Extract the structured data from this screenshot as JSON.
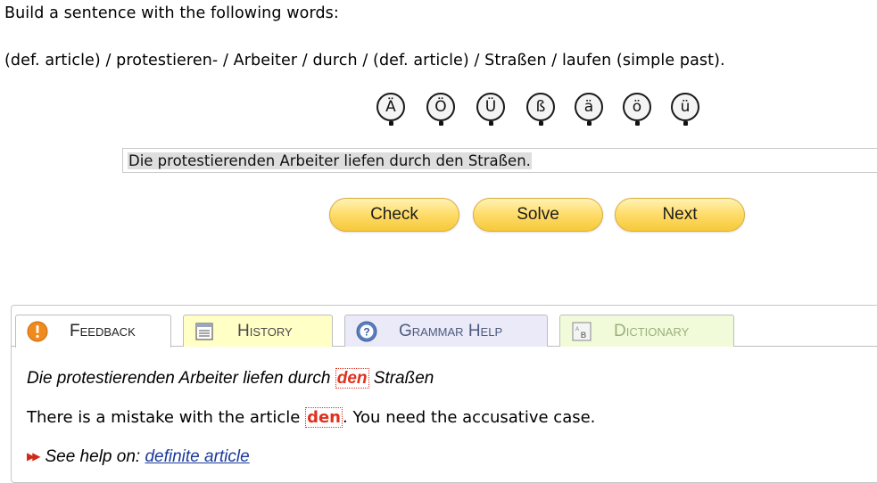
{
  "instruction": "Build a sentence with the following words:",
  "words": "(def. article) / protestieren- / Arbeiter / durch / (def. article) / Straßen / laufen (simple past).",
  "special_chars": [
    "Ä",
    "Ö",
    "Ü",
    "ß",
    "ä",
    "ö",
    "ü"
  ],
  "answer": {
    "value": "Die protestierenden Arbeiter liefen durch den Straßen."
  },
  "buttons": {
    "check": "Check",
    "solve": "Solve",
    "next": "Next"
  },
  "tabs": {
    "feedback": "Feedback",
    "history": "History",
    "grammar_help": "Grammar Help",
    "dictionary": "Dictionary",
    "active": "feedback"
  },
  "feedback": {
    "sentence_before": "Die protestierenden Arbeiter liefen durch ",
    "sentence_error": "den",
    "sentence_after": " Straßen",
    "message_before": "There is a mistake with the article ",
    "message_error": "den",
    "message_after": ". You need the accusative case.",
    "help_prefix": "See help on: ",
    "help_link": "definite article"
  },
  "colors": {
    "button_fill": "#ffde6e",
    "error_red": "#e0301e",
    "link_blue": "#1a3a9a",
    "history_tab": "#ffffc6",
    "grammar_tab": "#eaeaf8",
    "dictionary_tab": "#f1fbda"
  },
  "icons": {
    "feedback": "alert-icon",
    "history": "history-icon",
    "grammar_help": "help-icon",
    "dictionary": "dictionary-icon",
    "help_arrows": "double-arrow-icon"
  }
}
